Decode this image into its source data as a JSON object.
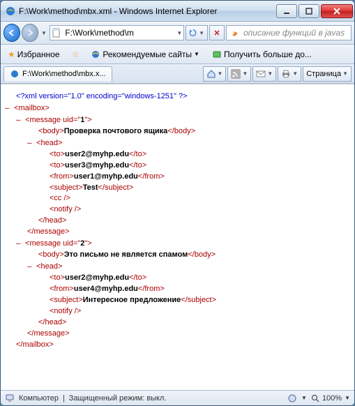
{
  "window": {
    "title": "F:\\Work\\method\\mbx.xml - Windows Internet Explorer"
  },
  "nav": {
    "address": "F:\\Work\\method\\m",
    "search_placeholder": "описание функций в javas"
  },
  "favbar": {
    "favorites": "Избранное",
    "recommended": "Рекомендуемые сайты",
    "getmore": "Получить больше до..."
  },
  "tab": {
    "label": "F:\\Work\\method\\mbx.x..."
  },
  "cmdbar": {
    "page": "Страница"
  },
  "statusbar": {
    "computer": "Компьютер",
    "protected": "Защищенный режим: выкл.",
    "zoom": "100%"
  },
  "xml": {
    "decl": "<?xml version=\"1.0\" encoding=\"windows-1251\" ?>",
    "root": "mailbox",
    "msg_tag": "message",
    "uid_attr": "uid",
    "body_tag": "body",
    "head_tag": "head",
    "to_tag": "to",
    "from_tag": "from",
    "subject_tag": "subject",
    "cc_tag": "cc",
    "notify_tag": "notify",
    "messages": [
      {
        "uid": "1",
        "body": "Проверка почтового ящика",
        "to": [
          "user2@myhp.edu",
          "user3@myhp.edu"
        ],
        "from": "user1@myhp.edu",
        "subject": "Test",
        "has_cc": true
      },
      {
        "uid": "2",
        "body": "Это письмо не является спамом",
        "to": [
          "user2@myhp.edu"
        ],
        "from": "user4@myhp.edu",
        "subject": "Интересное предложение",
        "has_cc": false
      }
    ]
  }
}
